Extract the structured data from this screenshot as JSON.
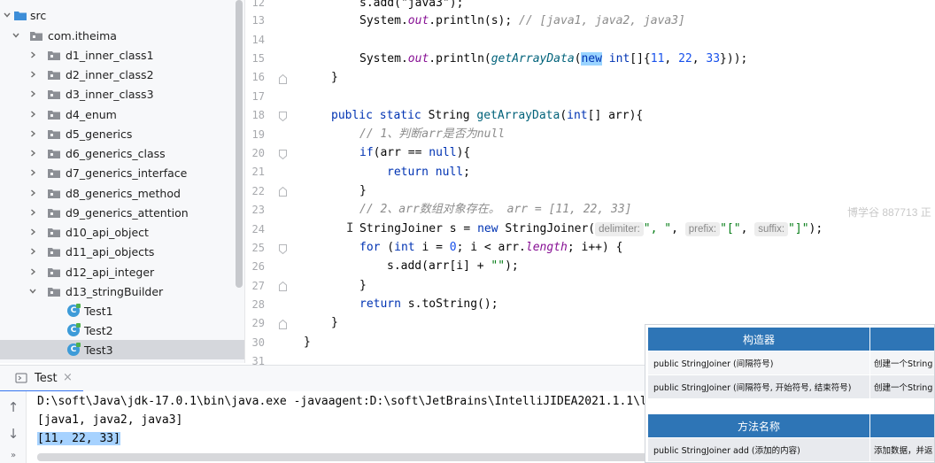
{
  "project_tree": {
    "src_label": "src",
    "package_label": "com.itheima",
    "folders": [
      "d1_inner_class1",
      "d2_inner_class2",
      "d3_inner_class3",
      "d4_enum",
      "d5_generics",
      "d6_generics_class",
      "d7_generics_interface",
      "d8_generics_method",
      "d9_generics_attention",
      "d10_api_object",
      "d11_api_objects",
      "d12_api_integer"
    ],
    "open_folder": "d13_stringBuilder",
    "classes": [
      "Test1",
      "Test2",
      "Test3"
    ],
    "selected_class": "Test3"
  },
  "editor": {
    "line_numbers": [
      "12",
      "13",
      "14",
      "15",
      "16",
      "17",
      "18",
      "19",
      "20",
      "21",
      "22",
      "23",
      "24",
      "25",
      "26",
      "27",
      "28",
      "29",
      "30",
      "31"
    ],
    "code": {
      "l12": "s.add(\"java3\");",
      "l13_sys": "System.",
      "l13_out": "out",
      "l13_call": ".println(s); ",
      "l13_comment": "// [java1, java2, java3]",
      "l15_sys": "System.",
      "l15_out": "out",
      "l15_a": ".println(",
      "l15_method": "getArrayData",
      "l15_b": "(",
      "l15_new": "new",
      "l15_int": " int",
      "l15_c": "[]{",
      "l15_n1": "11",
      "l15_n2": "22",
      "l15_n3": "33",
      "l15_d": "}));",
      "l16": "}",
      "l18_public": "public",
      "l18_static": "static",
      "l18_rest": " String ",
      "l18_method": "getArrayData",
      "l18_int": "int",
      "l18_args": "[] arr){",
      "l19": "// 1、判断arr是否为null",
      "l20_if": "if",
      "l20_a": "(arr == ",
      "l20_null": "null",
      "l20_b": "){",
      "l21_return": "return",
      "l21_null": "null",
      "l21_end": ";",
      "l22": "}",
      "l23": "// 2、arr数组对象存在。 arr = [11, 22, 33]",
      "l24_a": "StringJoiner s = ",
      "l24_new": "new",
      "l24_b": " StringJoiner(",
      "l24_hint1": "delimiter:",
      "l24_s1": "\", \"",
      "l24_hint2": "prefix:",
      "l24_s2": "\"[\"",
      "l24_hint3": "suffix:",
      "l24_s3": "\"]\"",
      "l24_end": ");",
      "l25_for": "for",
      "l25_a": " (",
      "l25_int": "int",
      "l25_b": " i = ",
      "l25_zero": "0",
      "l25_c": "; i < arr.",
      "l25_length": "length",
      "l25_d": "; i++) {",
      "l26_a": "s.add(arr[i] + ",
      "l26_str": "\"\"",
      "l26_b": ");",
      "l27": "}",
      "l28_return": "return",
      "l28_rest": " s.toString();",
      "l29": "}",
      "l30": "}"
    }
  },
  "watermark": "博学谷 887713 正",
  "run_panel": {
    "tab_label": "Test",
    "command": "D:\\soft\\Java\\jdk-17.0.1\\bin\\java.exe -javaagent:D:\\soft\\JetBrains\\IntelliJIDEA2021.1.1\\l",
    "output_line1": "[java1, java2, java3]",
    "output_line2": "[11, 22, 33]"
  },
  "overlay_table": {
    "header_constructor": "构造器",
    "row1_left": "public StringJoiner (间隔符号)",
    "row1_right": "创建一个String",
    "row2_left": "public StringJoiner (间隔符号, 开始符号, 结束符号)",
    "row2_right": "创建一个String",
    "header_method": "方法名称",
    "row3_left": "public StringJoiner add (添加的内容)",
    "row3_right": "添加数据，并返"
  }
}
